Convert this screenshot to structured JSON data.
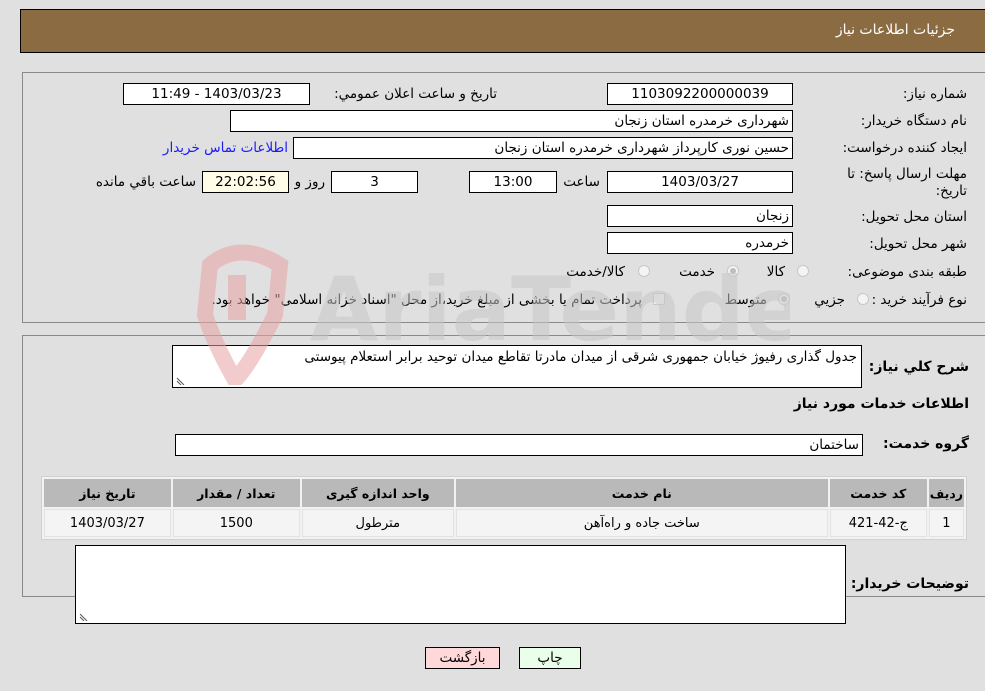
{
  "header": {
    "title": "جزئیات اطلاعات نیاز"
  },
  "form": {
    "need_number": {
      "label": "شماره نیاز:",
      "value": "1103092200000039"
    },
    "announce_datetime": {
      "label": "تاریخ و ساعت اعلان عمومي:",
      "value": "1403/03/23 - 11:49"
    },
    "buyer_org": {
      "label": "نام دستگاه خريدار:",
      "value": "شهرداری خرمدره استان زنجان"
    },
    "requester": {
      "label": "ايجاد کننده درخواست:",
      "value": "حسین نوری کارپرداز شهرداری خرمدره استان زنجان"
    },
    "buyer_contact_link": "اطلاعات تماس خريدار",
    "deadline": {
      "label_line1": "مهلت ارسال پاسخ: تا",
      "label_line2": "تاریخ:",
      "date": "1403/03/27",
      "time_label": "ساعت",
      "time": "13:00",
      "days": "3",
      "days_label": "روز و",
      "remaining": "22:02:56",
      "remaining_label": "ساعت باقي مانده"
    },
    "delivery_province": {
      "label": "استان محل تحويل:",
      "value": "زنجان"
    },
    "delivery_city": {
      "label": "شهر محل تحويل:",
      "value": "خرمدره"
    },
    "category": {
      "label": "طبقه بندی موضوعی:",
      "options": [
        {
          "label": "کالا",
          "selected": false
        },
        {
          "label": "خدمت",
          "selected": true
        },
        {
          "label": "کالا/خدمت",
          "selected": false
        }
      ]
    },
    "purchase_type": {
      "label": "نوع فرآيند خريد :",
      "options": [
        {
          "label": "جزيي",
          "selected": false
        },
        {
          "label": "متوسط",
          "selected": true
        }
      ],
      "treasury_note": "پرداخت تمام يا بخشی از مبلغ خريد،از محل \"اسناد خزانه اسلامی\" خواهد بود.",
      "treasury_checked": false
    }
  },
  "details": {
    "description_label": "شرح کلي نياز:",
    "description": "جدول گذاری رفیوژ خیابان جمهوری شرقی از میدان مادرتا تقاطع میدان توحید برابر استعلام پیوستی",
    "services_title": "اطلاعات خدمات مورد نياز",
    "service_group_label": "گروه خدمت:",
    "service_group": "ساختمان",
    "table": {
      "headers": [
        "رديف",
        "کد خدمت",
        "نام خدمت",
        "واحد اندازه گيری",
        "تعداد / مقدار",
        "تاريخ نياز"
      ],
      "rows": [
        [
          "1",
          "ج-42-421",
          "ساخت جاده و راه‌آهن",
          "مترطول",
          "1500",
          "1403/03/27"
        ]
      ]
    },
    "buyer_notes_label": "توضيحات خريدار:",
    "buyer_notes": ""
  },
  "buttons": {
    "print": "چاپ",
    "back": "بازگشت"
  },
  "watermark": {
    "text": "AriaTender.neT"
  }
}
